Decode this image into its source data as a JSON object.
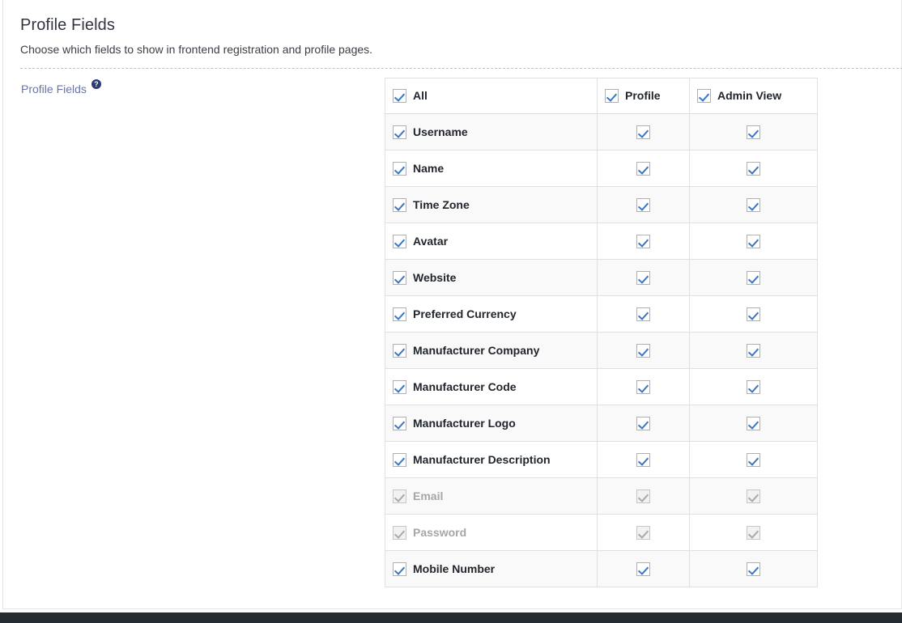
{
  "header": {
    "title": "Profile Fields",
    "subtitle": "Choose which fields to show in frontend registration and profile pages."
  },
  "form": {
    "field_label": "Profile Fields",
    "help_icon": "help-circle-icon",
    "help_glyph": "?"
  },
  "matrix": {
    "columns": [
      {
        "key": "name",
        "label": "All",
        "checked": true,
        "type": "name"
      },
      {
        "key": "profile",
        "label": "Profile",
        "checked": true,
        "type": "check"
      },
      {
        "key": "admin",
        "label": "Admin View",
        "checked": true,
        "type": "check"
      }
    ],
    "rows": [
      {
        "label": "Username",
        "all": true,
        "profile": true,
        "admin": true,
        "disabled": false
      },
      {
        "label": "Name",
        "all": true,
        "profile": true,
        "admin": true,
        "disabled": false
      },
      {
        "label": "Time Zone",
        "all": true,
        "profile": true,
        "admin": true,
        "disabled": false
      },
      {
        "label": "Avatar",
        "all": true,
        "profile": true,
        "admin": true,
        "disabled": false
      },
      {
        "label": "Website",
        "all": true,
        "profile": true,
        "admin": true,
        "disabled": false
      },
      {
        "label": "Preferred Currency",
        "all": true,
        "profile": true,
        "admin": true,
        "disabled": false
      },
      {
        "label": "Manufacturer Company",
        "all": true,
        "profile": true,
        "admin": true,
        "disabled": false
      },
      {
        "label": "Manufacturer Code",
        "all": true,
        "profile": true,
        "admin": true,
        "disabled": false
      },
      {
        "label": "Manufacturer Logo",
        "all": true,
        "profile": true,
        "admin": true,
        "disabled": false
      },
      {
        "label": "Manufacturer Description",
        "all": true,
        "profile": true,
        "admin": true,
        "disabled": false
      },
      {
        "label": "Email",
        "all": true,
        "profile": true,
        "admin": true,
        "disabled": true
      },
      {
        "label": "Password",
        "all": true,
        "profile": true,
        "admin": true,
        "disabled": true
      },
      {
        "label": "Mobile Number",
        "all": true,
        "profile": true,
        "admin": true,
        "disabled": false
      }
    ]
  },
  "colors": {
    "accent_check": "#3a76c4",
    "label_link": "#6a74a8",
    "help_badge": "#2b3a75",
    "row_stripe": "#f9f9f9",
    "footer_bar": "#252d33",
    "text_primary": "#22262c",
    "text_disabled": "#a6a6a6"
  }
}
